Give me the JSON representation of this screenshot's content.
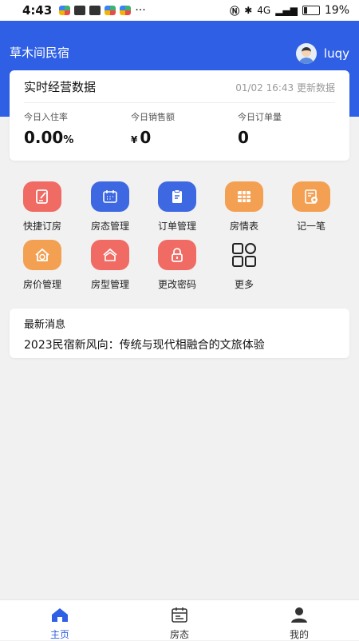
{
  "status_bar": {
    "time": "4:43",
    "more": "···",
    "network": "4G",
    "battery": "19%"
  },
  "header": {
    "app_title": "草木间民宿",
    "username": "luqy"
  },
  "stats": {
    "title": "实时经营数据",
    "updated": "01/02 16:43 更新数据",
    "occupancy": {
      "label": "今日入住率",
      "value": "0.00",
      "unit": "%"
    },
    "sales": {
      "label": "今日销售额",
      "currency": "¥",
      "value": "0"
    },
    "orders": {
      "label": "今日订单量",
      "value": "0"
    }
  },
  "menu": [
    {
      "label": "快捷订房",
      "icon": "quick-booking-icon",
      "color": "#f06b64"
    },
    {
      "label": "房态管理",
      "icon": "calendar-icon",
      "color": "#3e68e2"
    },
    {
      "label": "订单管理",
      "icon": "clipboard-icon",
      "color": "#3e68e2"
    },
    {
      "label": "房情表",
      "icon": "grid-table-icon",
      "color": "#f3a053"
    },
    {
      "label": "记一笔",
      "icon": "bill-icon",
      "color": "#f3a053"
    },
    {
      "label": "房价管理",
      "icon": "price-icon",
      "color": "#f3a053"
    },
    {
      "label": "房型管理",
      "icon": "house-icon",
      "color": "#f06b64"
    },
    {
      "label": "更改密码",
      "icon": "lock-icon",
      "color": "#f06b64"
    },
    {
      "label": "更多",
      "icon": "apps-icon",
      "color": ""
    }
  ],
  "news": {
    "title": "最新消息",
    "item": "2023民宿新风向：传统与现代相融合的文旅体验"
  },
  "tabs": [
    {
      "label": "主页",
      "icon": "home-icon",
      "active": true
    },
    {
      "label": "房态",
      "icon": "calendar-icon",
      "active": false
    },
    {
      "label": "我的",
      "icon": "user-icon",
      "active": false
    }
  ],
  "colors": {
    "primary": "#2f5fe4",
    "background": "#f1f1f1"
  }
}
